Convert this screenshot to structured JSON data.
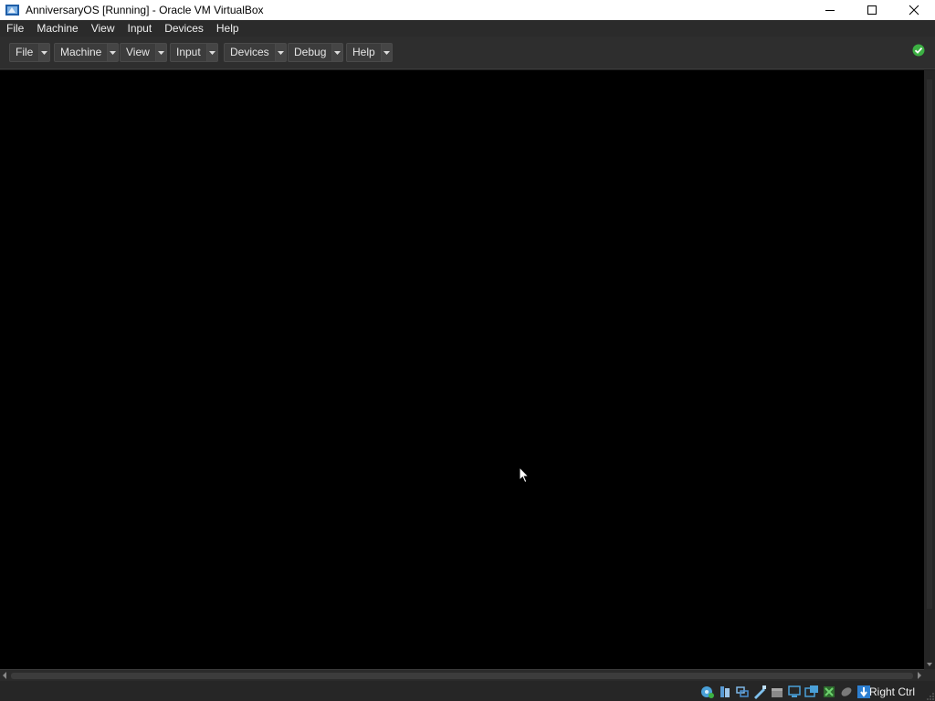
{
  "window": {
    "title": "AnniversaryOS [Running] - Oracle VM VirtualBox"
  },
  "menubar": {
    "items": [
      {
        "label": "File"
      },
      {
        "label": "Machine"
      },
      {
        "label": "View"
      },
      {
        "label": "Input"
      },
      {
        "label": "Devices"
      },
      {
        "label": "Help"
      }
    ]
  },
  "toolbar": {
    "buttons": [
      {
        "label": "File"
      },
      {
        "label": "Machine"
      },
      {
        "label": "View"
      },
      {
        "label": "Input"
      },
      {
        "label": "Devices"
      },
      {
        "label": "Debug"
      },
      {
        "label": "Help"
      }
    ],
    "status_icon": "check-circle-icon",
    "status_color": "#3cb043"
  },
  "vm_screen": {
    "background": "#000000",
    "cursor_icon": "mouse-pointer-icon"
  },
  "statusbar": {
    "icons": [
      "hard-disk-icon",
      "optical-drive-icon",
      "audio-icon",
      "network-icon",
      "usb-icon",
      "shared-folders-icon",
      "display-icon",
      "video-capture-icon",
      "cpu-icon",
      "mouse-integration-icon",
      "keyboard-capture-icon"
    ],
    "host_key": "Right Ctrl"
  }
}
